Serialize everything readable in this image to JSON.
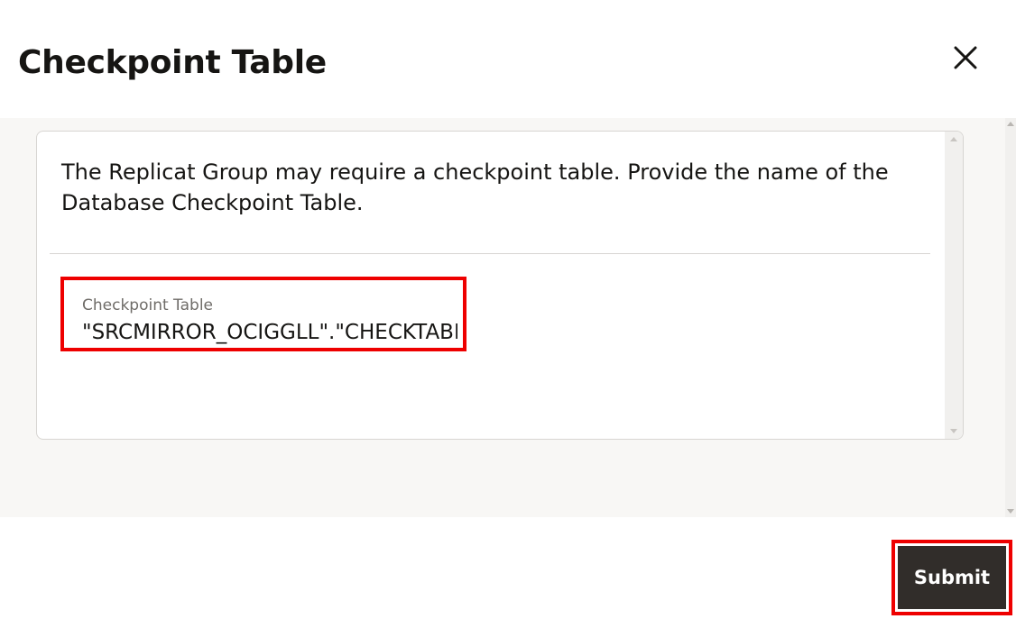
{
  "dialog": {
    "title": "Checkpoint Table",
    "close_icon": "close-icon"
  },
  "content": {
    "description": "The Replicat Group may require a checkpoint table. Provide the name of the Database Checkpoint Table.",
    "checkpoint_field": {
      "label": "Checkpoint Table",
      "value": "\"SRCMIRROR_OCIGGLL\".\"CHECKTABLE\""
    }
  },
  "footer": {
    "submit_label": "Submit"
  },
  "colors": {
    "highlight": "#ee0000",
    "button_bg": "#312d2a",
    "body_bg": "#f8f7f5",
    "text": "#161513"
  }
}
